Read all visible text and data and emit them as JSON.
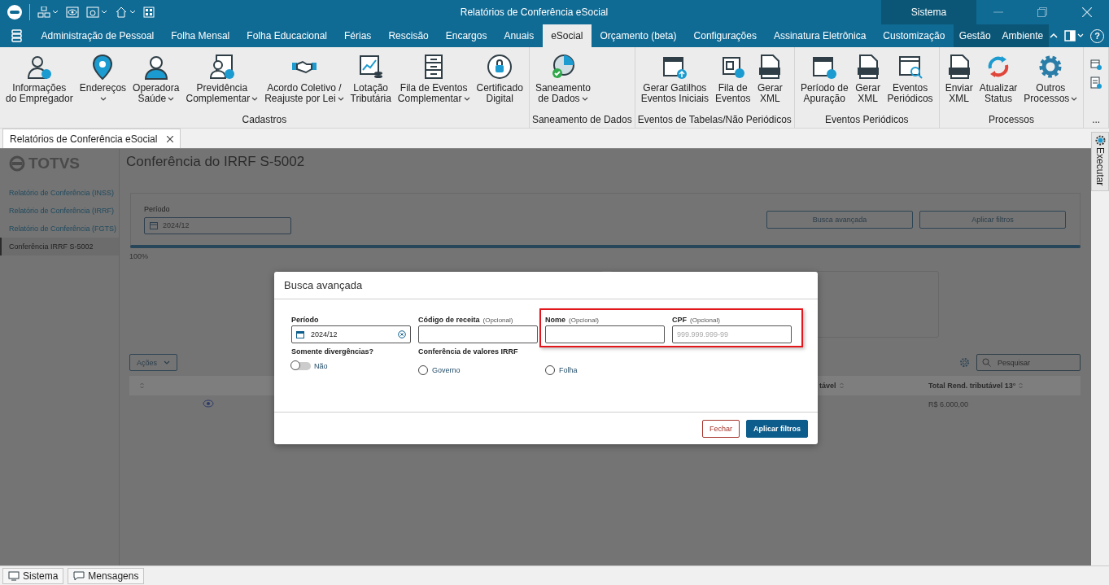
{
  "window": {
    "title": "Relatórios de Conferência eSocial",
    "context_group": "Sistema"
  },
  "menu_tabs": [
    {
      "label": "Administração de Pessoal",
      "selected": false
    },
    {
      "label": "Folha Mensal",
      "selected": false
    },
    {
      "label": "Folha Educacional",
      "selected": false
    },
    {
      "label": "Férias",
      "selected": false
    },
    {
      "label": "Rescisão",
      "selected": false
    },
    {
      "label": "Encargos",
      "selected": false
    },
    {
      "label": "Anuais",
      "selected": false
    },
    {
      "label": "eSocial",
      "selected": true
    },
    {
      "label": "Orçamento (beta)",
      "selected": false
    },
    {
      "label": "Configurações",
      "selected": false
    },
    {
      "label": "Assinatura Eletrônica",
      "selected": false
    },
    {
      "label": "Customização",
      "selected": false
    }
  ],
  "context_tabs": [
    {
      "label": "Gestão",
      "selected": false
    },
    {
      "label": "Ambiente",
      "selected": false
    }
  ],
  "help": "?",
  "ribbon_groups": [
    {
      "title": "Cadastros",
      "buttons": [
        {
          "lines": [
            "Informações",
            "do Empregador"
          ],
          "dropdown": false
        },
        {
          "lines": [
            "Endereços"
          ],
          "dropdown": true
        },
        {
          "lines": [
            "Operadora",
            "Saúde"
          ],
          "dropdown": true
        },
        {
          "lines": [
            "Previdência",
            "Complementar"
          ],
          "dropdown": true
        },
        {
          "lines": [
            "Acordo Coletivo /",
            "Reajuste por Lei"
          ],
          "dropdown": true
        },
        {
          "lines": [
            "Lotação",
            "Tributária"
          ],
          "dropdown": false
        },
        {
          "lines": [
            "Fila de Eventos",
            "Complementar"
          ],
          "dropdown": true
        },
        {
          "lines": [
            "Certificado",
            "Digital"
          ],
          "dropdown": false
        }
      ]
    },
    {
      "title": "Saneamento de Dados",
      "buttons": [
        {
          "lines": [
            "Saneamento",
            "de Dados"
          ],
          "dropdown": true
        }
      ]
    },
    {
      "title": "Eventos de Tabelas/Não Periódicos",
      "buttons": [
        {
          "lines": [
            "Gerar Gatilhos",
            "Eventos Iniciais"
          ],
          "dropdown": false
        },
        {
          "lines": [
            "Fila de",
            "Eventos"
          ],
          "dropdown": false
        },
        {
          "lines": [
            "Gerar",
            "XML"
          ],
          "dropdown": false
        }
      ]
    },
    {
      "title": "Eventos Periódicos",
      "buttons": [
        {
          "lines": [
            "Período de",
            "Apuração"
          ],
          "dropdown": false
        },
        {
          "lines": [
            "Gerar",
            "XML"
          ],
          "dropdown": false
        },
        {
          "lines": [
            "Eventos",
            "Periódicos"
          ],
          "dropdown": false
        }
      ]
    },
    {
      "title": "Processos",
      "buttons": [
        {
          "lines": [
            "Enviar",
            "XML"
          ],
          "dropdown": false
        },
        {
          "lines": [
            "Atualizar",
            "Status"
          ],
          "dropdown": false
        },
        {
          "lines": [
            "Outros",
            "Processos"
          ],
          "dropdown": true
        }
      ]
    }
  ],
  "ribbon_overflow": {
    "title": "..."
  },
  "doc_tabs": [
    {
      "label": "Relatórios de Conferência eSocial",
      "selected": true
    }
  ],
  "side_panel": {
    "label": "Executar"
  },
  "sidebar": {
    "logo": "TOTVS",
    "items": [
      {
        "label": "Relatório de Conferência (INSS)",
        "selected": false
      },
      {
        "label": "Relatório de Conferência (IRRF)",
        "selected": false
      },
      {
        "label": "Relatório de Conferência (FGTS)",
        "selected": false
      },
      {
        "label": "Conferência IRRF S-5002",
        "selected": true
      }
    ]
  },
  "content": {
    "title": "Conferência do IRRF S-5002",
    "filter": {
      "label": "Período",
      "value": "2024/12"
    },
    "buttons": [
      "Busca avançada",
      "Aplicar filtros"
    ],
    "progress": {
      "level": 1,
      "reading": "100%"
    },
    "actions_button": "Ações",
    "search": {
      "placeholder": "Pesquisar"
    },
    "table": {
      "columns": [
        {
          "sortable": true
        },
        {
          "label": "tável",
          "sortable": true
        },
        {
          "label": "Total Rend. tributável 13°",
          "sortable": true
        }
      ],
      "rows": [
        {
          "column_3": "R$ 6.000,00"
        }
      ]
    }
  },
  "modal": {
    "title": "Busca avançada",
    "fields": [
      {
        "label": "Período",
        "kind": "date",
        "value": "2024/12",
        "highlighted": false
      },
      {
        "label": "Código de receita",
        "hint": "(Opcional)",
        "kind": "text",
        "highlighted": false
      },
      {
        "label": "Nome",
        "hint": "(Opcional)",
        "kind": "text",
        "highlighted": true
      },
      {
        "label": "CPF",
        "hint": "(Opcional)",
        "kind": "text",
        "placeholder": "999.999.999-99",
        "highlighted": true
      }
    ],
    "toggle": {
      "label": "Somente divergências?",
      "on": false,
      "text": "Não"
    },
    "radio_group": {
      "label": "Conferência de valores IRRF",
      "options": [
        {
          "label": "Governo",
          "selected": false
        },
        {
          "label": "Folha",
          "selected": false
        }
      ]
    },
    "buttons": [
      {
        "label": "Fechar",
        "kind": "secondary"
      },
      {
        "label": "Aplicar filtros",
        "kind": "primary"
      }
    ]
  },
  "status_bar": [
    {
      "label": "Sistema"
    },
    {
      "label": "Mensagens"
    }
  ]
}
